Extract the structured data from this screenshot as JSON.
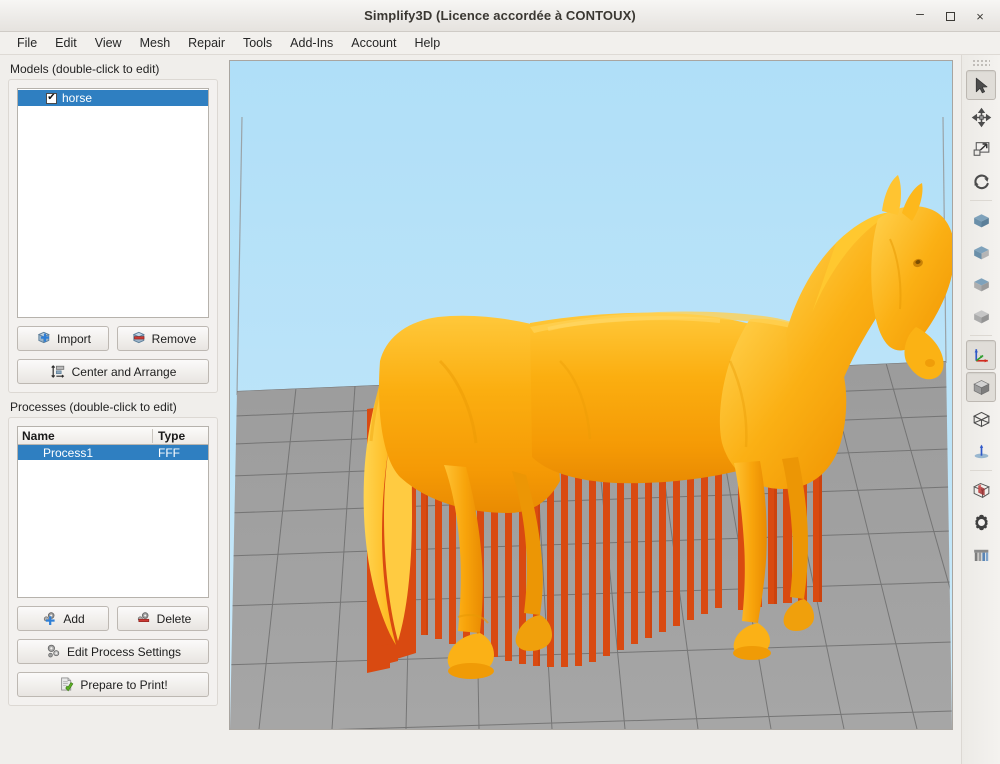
{
  "window": {
    "title": "Simplify3D (Licence accordée à CONTOUX)",
    "minimize_label": "–",
    "maximize_label": "",
    "close_label": "×"
  },
  "menubar": {
    "items": [
      {
        "label": "File"
      },
      {
        "label": "Edit"
      },
      {
        "label": "View"
      },
      {
        "label": "Mesh"
      },
      {
        "label": "Repair"
      },
      {
        "label": "Tools"
      },
      {
        "label": "Add-Ins"
      },
      {
        "label": "Account"
      },
      {
        "label": "Help"
      }
    ]
  },
  "models_panel": {
    "title": "Models (double-click to edit)",
    "items": [
      {
        "name": "horse",
        "checked": true,
        "check_glyph": "✔",
        "selected": true
      }
    ],
    "import_label": "Import",
    "remove_label": "Remove",
    "center_arrange_label": "Center and Arrange"
  },
  "processes_panel": {
    "title": "Processes (double-click to edit)",
    "columns": [
      "Name",
      "Type"
    ],
    "rows": [
      {
        "name": "Process1",
        "type": "FFF",
        "selected": true
      }
    ],
    "add_label": "Add",
    "delete_label": "Delete",
    "edit_settings_label": "Edit Process Settings",
    "prepare_label": "Prepare to Print!"
  },
  "toolbar": {
    "items": [
      {
        "icon": "cursor-select-icon",
        "active": true
      },
      {
        "icon": "move-icon",
        "active": false
      },
      {
        "icon": "scale-icon",
        "active": false
      },
      {
        "icon": "rotate-icon",
        "active": false
      },
      {
        "icon": "view-cube-front-icon",
        "active": false
      },
      {
        "icon": "view-cube-side-icon",
        "active": false
      },
      {
        "icon": "view-cube-top-icon",
        "active": false
      },
      {
        "icon": "view-cube-iso-icon",
        "active": false
      },
      {
        "icon": "axes-origin-icon",
        "active": true
      },
      {
        "icon": "solid-cube-icon",
        "active": true
      },
      {
        "icon": "wireframe-cube-icon",
        "active": false
      },
      {
        "icon": "z-axis-icon",
        "active": false
      },
      {
        "icon": "cross-section-icon",
        "active": false
      },
      {
        "icon": "gear-settings-icon",
        "active": false
      },
      {
        "icon": "supports-icon",
        "active": false
      }
    ]
  },
  "viewport": {
    "model_name": "horse",
    "model_color": "#F5A105",
    "support_color": "#D94A11",
    "bed_color": "#9d9d9d",
    "sky_color": "#b8e2f9",
    "grid_line_color": "#6f6f6f",
    "build_volume_edge_color": "#9aa3a8"
  }
}
